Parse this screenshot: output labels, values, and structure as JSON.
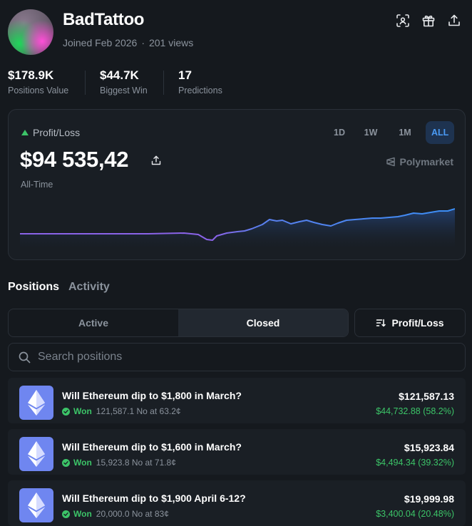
{
  "profile": {
    "username": "BadTattoo",
    "joined": "Joined Feb 2026",
    "separator": "·",
    "views": "201 views"
  },
  "header_icons": [
    "scan-icon",
    "gift-icon",
    "share-icon"
  ],
  "stats": [
    {
      "value": "$178.9K",
      "label": "Positions Value"
    },
    {
      "value": "$44.7K",
      "label": "Biggest Win"
    },
    {
      "value": "17",
      "label": "Predictions"
    }
  ],
  "pnl_card": {
    "label": "Profit/Loss",
    "value": "$94 535,42",
    "period": "All-Time",
    "brand": "Polymarket",
    "ranges": [
      "1D",
      "1W",
      "1M",
      "ALL"
    ],
    "active_range": "ALL"
  },
  "tabs": {
    "positions": "Positions",
    "activity": "Activity"
  },
  "filter": {
    "active": "Active",
    "closed": "Closed",
    "selected": "Closed",
    "sort_label": "Profit/Loss"
  },
  "search": {
    "placeholder": "Search positions"
  },
  "positions": [
    {
      "title": "Will Ethereum dip to $1,800 in March?",
      "status": "Won",
      "detail": "121,587.1 No at 63.2¢",
      "value": "$121,587.13",
      "pnl": "$44,732.88 (58.2%)"
    },
    {
      "title": "Will Ethereum dip to $1,600 in March?",
      "status": "Won",
      "detail": "15,923.8 No at 71.8¢",
      "value": "$15,923.84",
      "pnl": "$4,494.34 (39.32%)"
    },
    {
      "title": "Will Ethereum dip to $1,900 April 6-12?",
      "status": "Won",
      "detail": "20,000.0 No at 83¢",
      "value": "$19,999.98",
      "pnl": "$3,400.04 (20.48%)"
    }
  ],
  "colors": {
    "background": "#15191e",
    "accent_blue": "#4a9bf5",
    "positive": "#3cc468",
    "line_start": "#8a63e8",
    "line_end": "#3b8ef5"
  }
}
